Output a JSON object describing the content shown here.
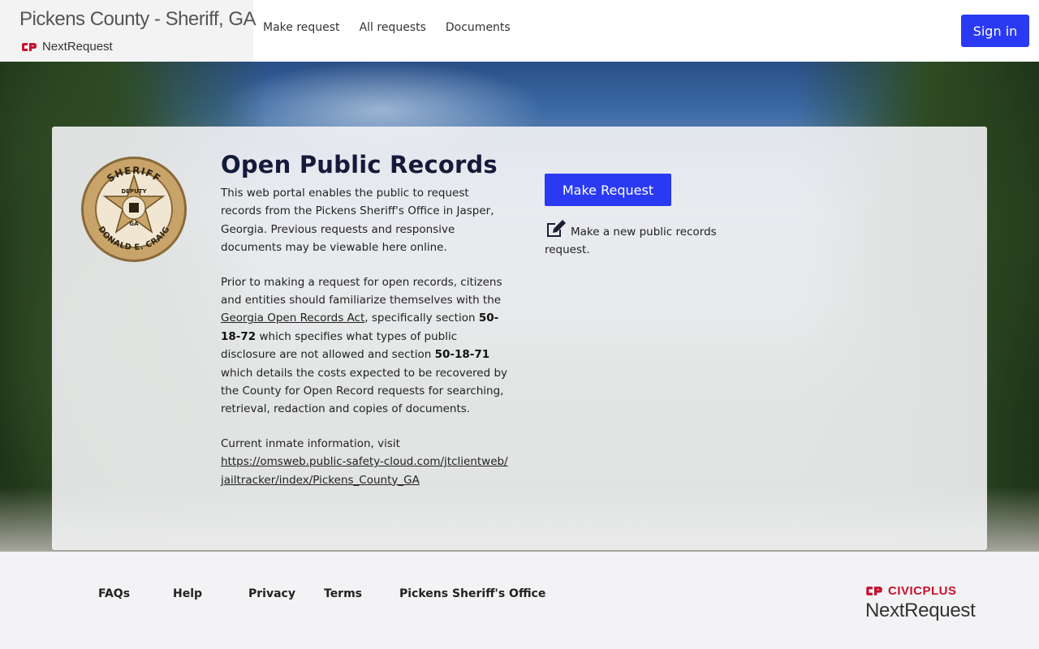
{
  "header": {
    "site_title": "Pickens County - Sheriff, GA",
    "logo_text": "NextRequest",
    "nav": [
      "Make request",
      "All requests",
      "Documents"
    ],
    "signin_label": "Sign in"
  },
  "badge": {
    "top_text": "SHERIFF",
    "bottom_text": "DONALD E. CRAIG",
    "star_text": "DEPUTY",
    "state": "GA"
  },
  "main": {
    "title": "Open Public Records",
    "intro": "This web portal enables the public to request records from the Pickens Sheriff's Office in Jasper, Georgia. Previous requests and responsive documents may be viewable here online.",
    "p2_a": "Prior to making a request for open records, citizens and entities should familiarize themselves with the ",
    "p2_link": "Georgia Open Records Act",
    "p2_b": ", specifically section ",
    "p2_sec1": "50-18-72",
    "p2_c": " which specifies what types of public disclosure are not allowed and section ",
    "p2_sec2": "50-18-71",
    "p2_d": " which details the costs expected to be recovered by the County for Open Record requests for searching, retrieval, redaction and copies of documents.",
    "p3_text": "Current inmate information, visit",
    "p3_link": "https://omsweb.public-safety-cloud.com/jtclientweb/jailtracker/index/Pickens_County_GA"
  },
  "cta": {
    "button_label": "Make Request",
    "description": "Make a new public records request."
  },
  "footer": {
    "links": [
      "FAQs",
      "Help",
      "Privacy",
      "Terms",
      "Pickens Sheriff's Office"
    ],
    "brand_name": "CIVICPLUS",
    "brand_product": "NextRequest"
  },
  "colors": {
    "primary": "#2a3af2",
    "civic_red": "#c8102e",
    "badge_gold": "#b8925a"
  }
}
